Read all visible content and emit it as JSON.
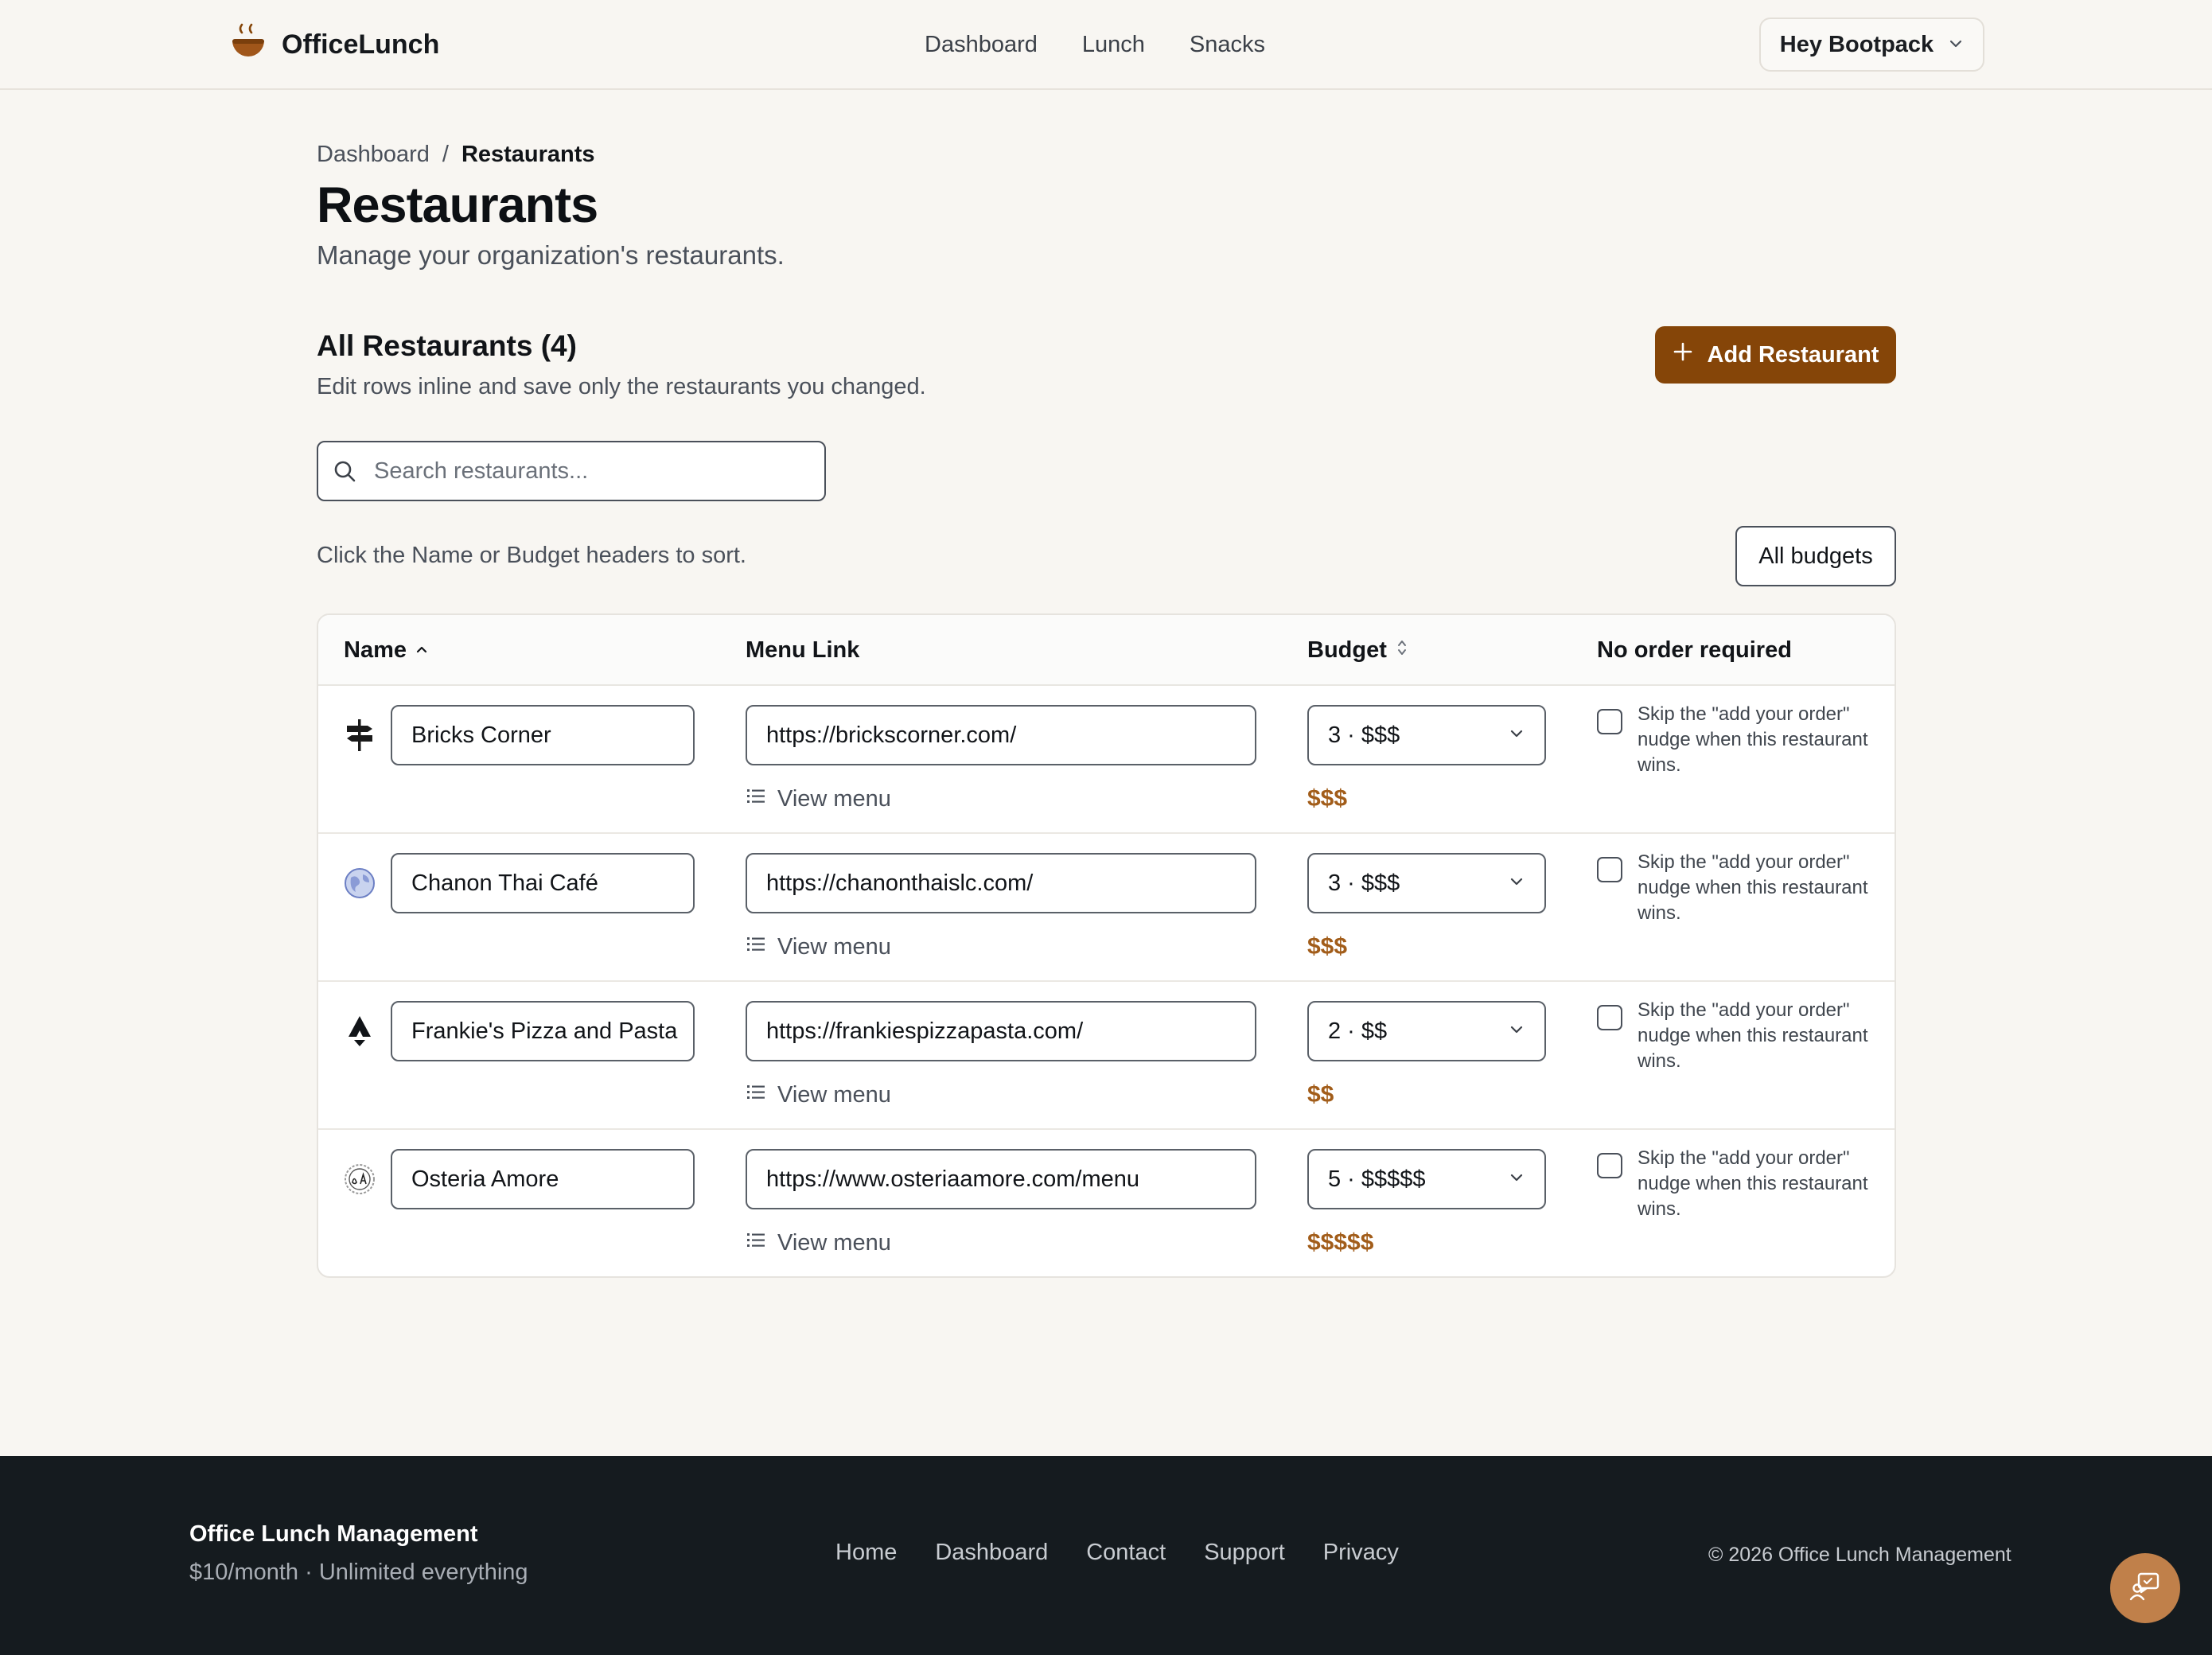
{
  "header": {
    "brand": "OfficeLunch",
    "nav": [
      "Dashboard",
      "Lunch",
      "Snacks"
    ],
    "user_menu": "Hey Bootpack"
  },
  "breadcrumb": {
    "parent": "Dashboard",
    "separator": "/",
    "current": "Restaurants"
  },
  "page": {
    "title": "Restaurants",
    "subtitle": "Manage your organization's restaurants."
  },
  "section": {
    "title": "All Restaurants (4)",
    "subtitle": "Edit rows inline and save only the restaurants you changed.",
    "add_button": "Add Restaurant"
  },
  "search": {
    "placeholder": "Search restaurants...",
    "value": ""
  },
  "sort_hint": "Click the Name or Budget headers to sort.",
  "budget_filter": "All budgets",
  "table": {
    "columns": [
      "Name",
      "Menu Link",
      "Budget",
      "No order required"
    ],
    "view_menu_label": "View menu",
    "checkbox_label": "Skip the \"add your order\" nudge when this restaurant wins.",
    "rows": [
      {
        "name": "Bricks Corner",
        "url": "https://brickscorner.com/",
        "budget": "3 · $$$",
        "dollars": "$$$",
        "no_order": false,
        "logo": "signpost-icon"
      },
      {
        "name": "Chanon Thai Café",
        "url": "https://chanonthaislc.com/",
        "budget": "3 · $$$",
        "dollars": "$$$",
        "no_order": false,
        "logo": "globe-icon"
      },
      {
        "name": "Frankie's Pizza and Pasta",
        "url": "https://frankiespizzapasta.com/",
        "budget": "2 · $$",
        "dollars": "$$",
        "no_order": false,
        "logo": "pizza-logo-icon"
      },
      {
        "name": "Osteria Amore",
        "url": "https://www.osteriaamore.com/menu",
        "budget": "5 · $$$$$",
        "dollars": "$$$$$",
        "no_order": false,
        "logo": "osteria-logo-icon"
      }
    ]
  },
  "footer": {
    "brand": "Office Lunch Management",
    "tagline": "$10/month · Unlimited everything",
    "nav": [
      "Home",
      "Dashboard",
      "Contact",
      "Support",
      "Privacy"
    ],
    "copyright": "© 2026 Office Lunch Management"
  },
  "colors": {
    "accent": "#854508",
    "dollars": "#a25d1a",
    "footer_bg": "#151b1f",
    "page_bg": "#f8f6f2"
  }
}
